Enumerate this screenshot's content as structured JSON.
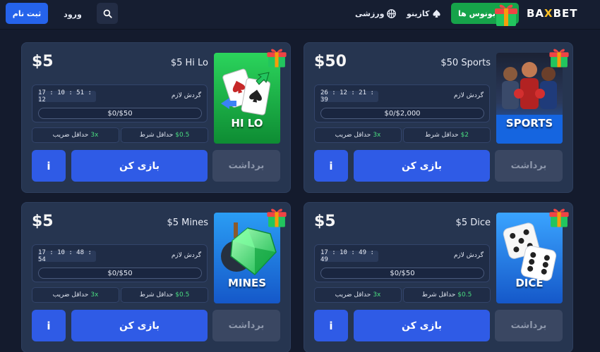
{
  "header": {
    "register_label": "ثبت نام",
    "login_label": "ورود",
    "nav_sports": "ورزشی",
    "nav_casino": "کازینو",
    "bonus_label": "بونوس ها",
    "logo_part1": "BA",
    "logo_x": "X",
    "logo_part2": "BET"
  },
  "cards": [
    {
      "amount": "$5",
      "title": "$5 Hi Lo",
      "thumb_label": "HI LO",
      "timer": "17 : 10 : 51 : 12",
      "wager_label": "گردش لازم",
      "progress": "$0/$50",
      "min_mult_label": "حداقل ضریب",
      "min_mult_value": "3x",
      "min_bet_label": "حداقل شرط",
      "min_bet_value": "$0.5",
      "info_label": "i",
      "play_label": "بازی کن",
      "withdraw_label": "برداشت"
    },
    {
      "amount": "$50",
      "title": "$50 Sports",
      "thumb_label": "SPORTS",
      "timer": "26 : 12 : 21 : 39",
      "wager_label": "گردش لازم",
      "progress": "$0/$2,000",
      "min_mult_label": "حداقل ضریب",
      "min_mult_value": "3x",
      "min_bet_label": "حداقل شرط",
      "min_bet_value": "$2",
      "info_label": "i",
      "play_label": "بازی کن",
      "withdraw_label": "برداشت"
    },
    {
      "amount": "$5",
      "title": "$5 Mines",
      "thumb_label": "MINES",
      "timer": "17 : 10 : 48 : 54",
      "wager_label": "گردش لازم",
      "progress": "$0/$50",
      "min_mult_label": "حداقل ضریب",
      "min_mult_value": "3x",
      "min_bet_label": "حداقل شرط",
      "min_bet_value": "$0.5",
      "info_label": "i",
      "play_label": "بازی کن",
      "withdraw_label": "برداشت"
    },
    {
      "amount": "$5",
      "title": "$5 Dice",
      "thumb_label": "DICE",
      "timer": "17 : 10 : 49 : 49",
      "wager_label": "گردش لازم",
      "progress": "$0/$50",
      "min_mult_label": "حداقل ضریب",
      "min_mult_value": "3x",
      "min_bet_label": "حداقل شرط",
      "min_bet_value": "$0.5",
      "info_label": "i",
      "play_label": "بازی کن",
      "withdraw_label": "برداشت"
    }
  ],
  "colors": {
    "primary": "#2f5be6",
    "bonus": "#16a34a",
    "accent_green": "#4ade80",
    "card_bg": "#263550",
    "page_bg": "#141b2d"
  },
  "icons": {
    "search": "search-icon",
    "casino": "spade-icon",
    "sports": "basketball-icon",
    "gift": "gift-icon"
  }
}
